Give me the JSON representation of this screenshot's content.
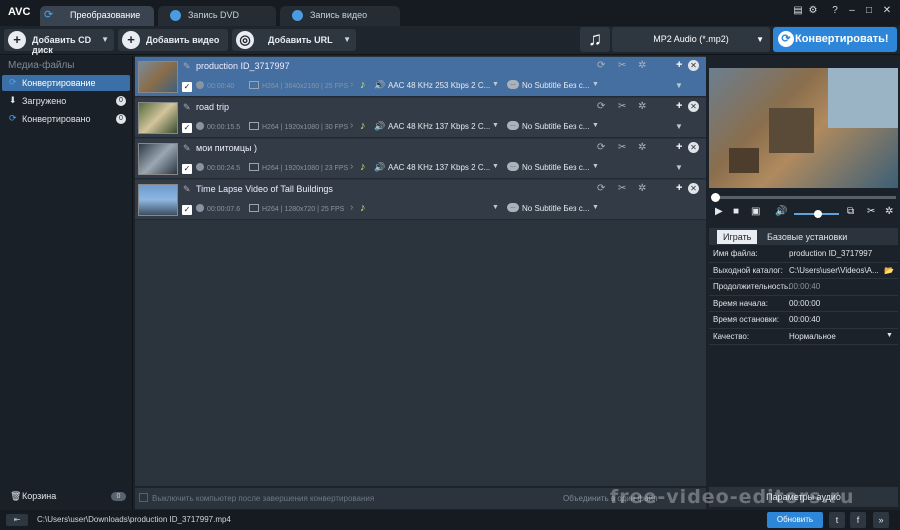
{
  "app": {
    "logo": "AVC"
  },
  "tabs": [
    {
      "label": "Преобразование"
    },
    {
      "label": "Запись DVD"
    },
    {
      "label": "Запись видео"
    }
  ],
  "toolbar": {
    "add_cd": "Добавить CD диск",
    "add_video": "Добавить видео",
    "add_url": "Добавить URL",
    "format": "MP2 Audio (*.mp2)",
    "convert": "Конвертировать!"
  },
  "sidebar": {
    "header": "Медиа-файлы",
    "items": [
      {
        "label": "Конвертирование"
      },
      {
        "label": "Загружено",
        "count": "0"
      },
      {
        "label": "Конвертировано",
        "count": "0"
      }
    ],
    "trash": {
      "label": "Корзина",
      "count": "0"
    }
  },
  "files": [
    {
      "name": "production ID_3717997",
      "duration": "00:00:40",
      "codec": "H264",
      "resolution": "3840x2160",
      "fps": "25 FPS",
      "audio": "AAC 48 KHz 253 Kbps 2 C...",
      "subtitle": "No Subtitle Без с..."
    },
    {
      "name": "road trip",
      "duration": "00:00:15.5",
      "codec": "H264",
      "resolution": "1920x1080",
      "fps": "30 FPS",
      "audio": "AAC 48 KHz 137 Kbps 2 C...",
      "subtitle": "No Subtitle Без с..."
    },
    {
      "name": "мои питомцы )",
      "duration": "00:00:24.5",
      "codec": "H264",
      "resolution": "1920x1080",
      "fps": "23 FPS",
      "audio": "AAC 48 KHz 137 Kbps 2 C...",
      "subtitle": "No Subtitle Без с..."
    },
    {
      "name": "Time Lapse Video of Tall Buildings",
      "duration": "00:00:07.6",
      "codec": "H264",
      "resolution": "1280x720",
      "fps": "25 FPS",
      "audio": "",
      "subtitle": "No Subtitle Без с..."
    }
  ],
  "bottom": {
    "shutdown": "Выключить компьютер после завершения конвертирования",
    "merge": "Объединить в один файл"
  },
  "preview": {
    "tabs": [
      "Играть",
      "Базовые установки"
    ],
    "props": [
      {
        "label": "Имя файла:",
        "value": "production ID_3717997"
      },
      {
        "label": "Выходной каталог:",
        "value": "C:\\Users\\user\\Videos\\A..."
      },
      {
        "label": "Продолжительность:",
        "value": "00:00:40"
      },
      {
        "label": "Время начала:",
        "value": "00:00:00"
      },
      {
        "label": "Время остановки:",
        "value": "00:00:40"
      },
      {
        "label": "Качество:",
        "value": "Нормальное"
      }
    ],
    "audio_params": "Параметры аудио"
  },
  "status": {
    "path": "C:\\Users\\user\\Downloads\\production ID_3717997.mp4",
    "update": "Обновить"
  },
  "watermark": "free-video-editors.ru",
  "colors": {
    "accent": "#2e86d8",
    "selected_row": "#466fa1",
    "sidebar_active": "#3a6fa8"
  }
}
